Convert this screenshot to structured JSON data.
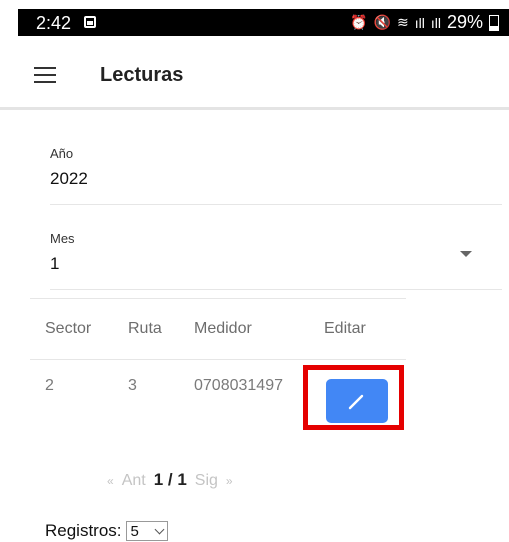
{
  "status_bar": {
    "time": "2:42",
    "battery": "29%",
    "icons": [
      "gallery-icon",
      "alarm-icon",
      "mute-icon",
      "wifi-icon",
      "signal-icon",
      "signal-icon",
      "battery-icon"
    ]
  },
  "appbar": {
    "title": "Lecturas",
    "menu_icon": "hamburger-icon"
  },
  "filters": {
    "year": {
      "label": "Año",
      "value": "2022"
    },
    "month": {
      "label": "Mes",
      "value": "1"
    }
  },
  "table": {
    "headers": [
      "Sector",
      "Ruta",
      "Medidor",
      "Editar"
    ],
    "rows": [
      {
        "sector": "2",
        "ruta": "3",
        "medidor": "0708031497"
      }
    ]
  },
  "pagination": {
    "first": "«",
    "prev": "Ant",
    "current": "1 / 1",
    "next": "Sig",
    "last": "»"
  },
  "registros": {
    "label": "Registros:",
    "value": "5"
  },
  "colors": {
    "accent": "#4287f5",
    "highlight": "#e50000"
  }
}
